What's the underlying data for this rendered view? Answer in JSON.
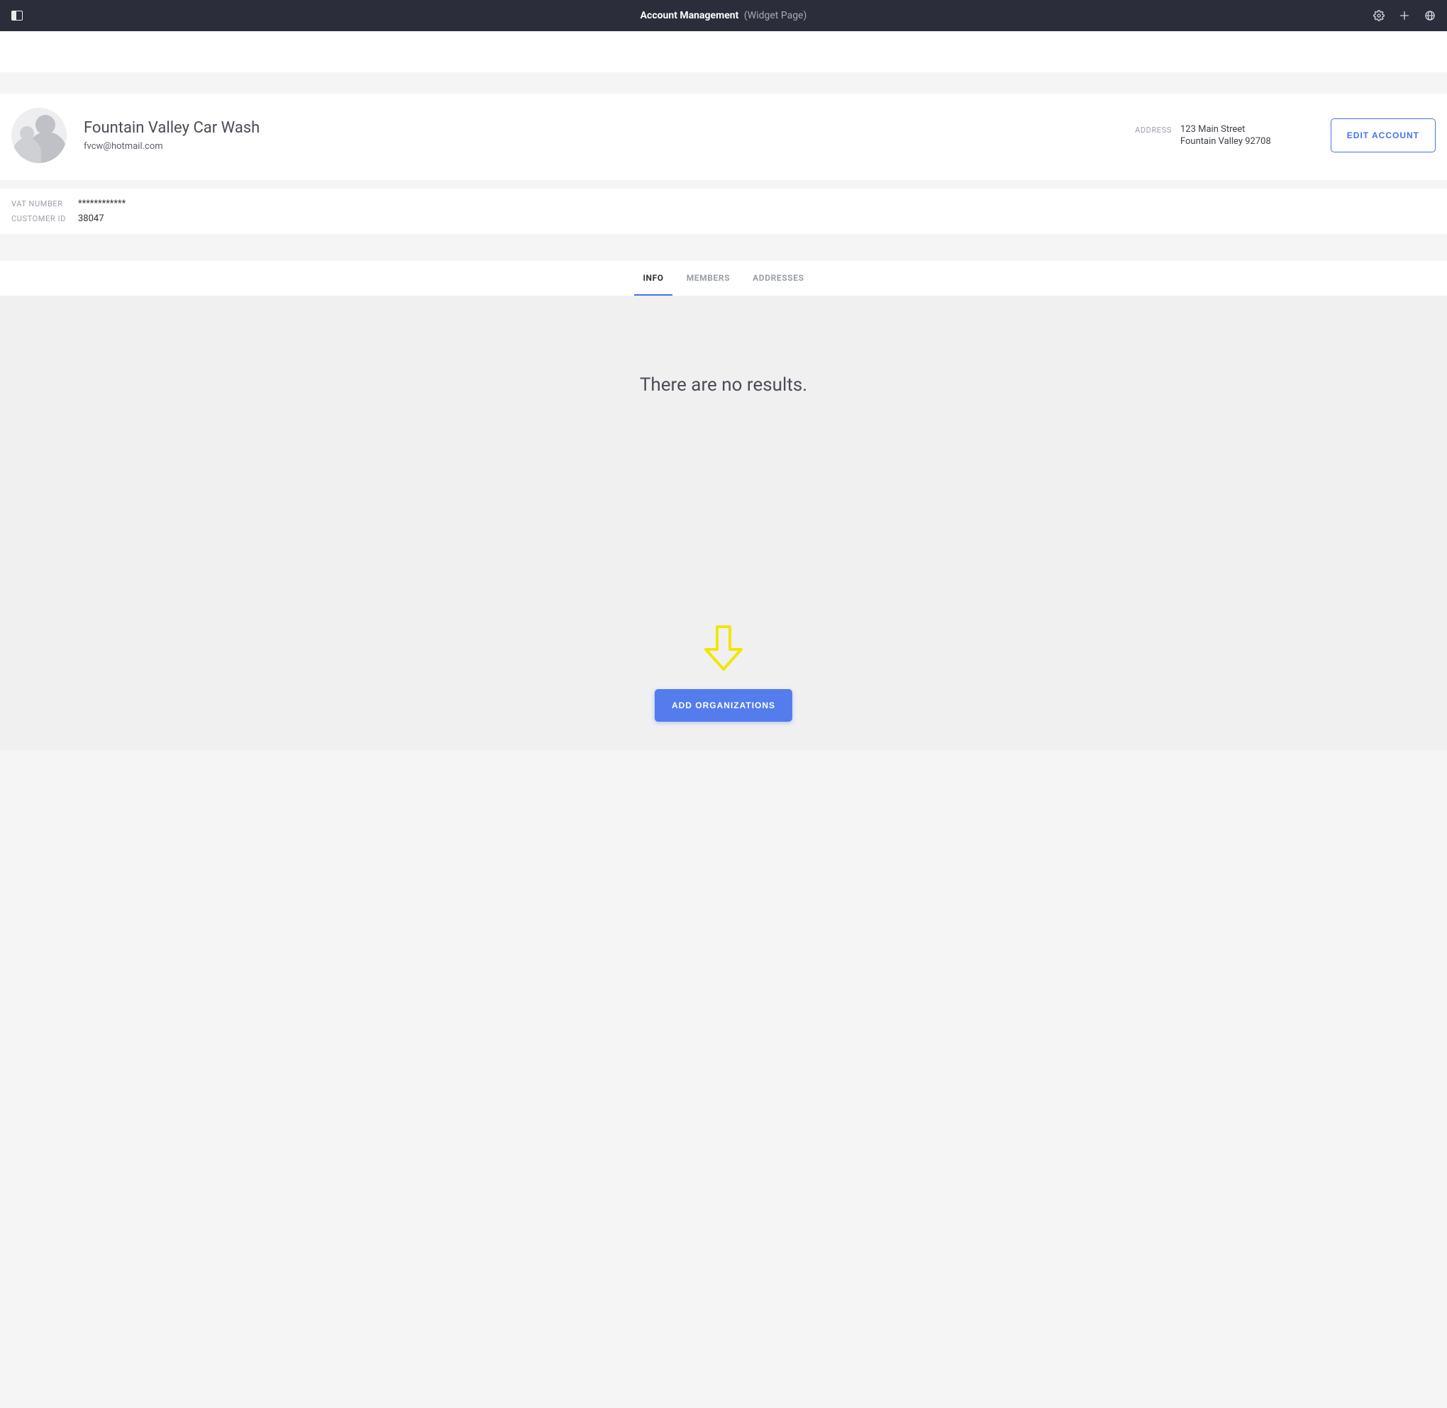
{
  "topbar": {
    "title_main": "Account Management",
    "title_sub": "(Widget Page)"
  },
  "account": {
    "name": "Fountain Valley Car Wash",
    "email": "fvcw@hotmail.com",
    "address_label": "ADDRESS",
    "address_line1": "123 Main Street",
    "address_line2": "Fountain Valley 92708",
    "edit_label": "Edit Account"
  },
  "details": {
    "vat_label": "VAT NUMBER",
    "vat_value": "************",
    "customer_id_label": "CUSTOMER ID",
    "customer_id_value": "38047"
  },
  "tabs": {
    "info": "Info",
    "members": "Members",
    "addresses": "Addresses"
  },
  "content": {
    "no_results": "There are no results.",
    "add_organizations": "Add Organizations"
  }
}
